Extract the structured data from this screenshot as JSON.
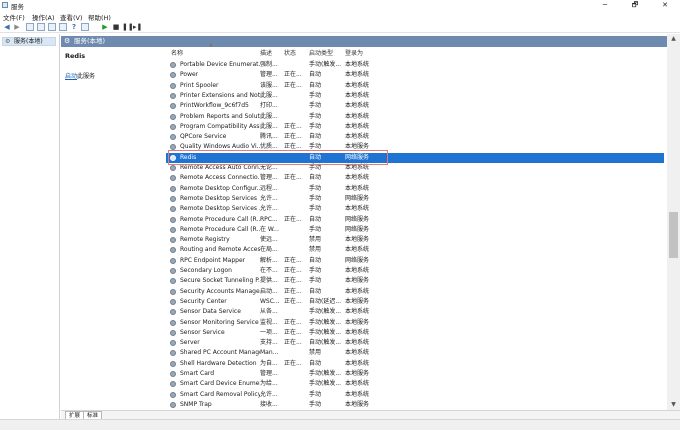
{
  "window": {
    "title": "服务",
    "minimize": "─",
    "maximize": "🗗",
    "close": "✕"
  },
  "menu": [
    "文件(F)",
    "操作(A)",
    "查看(V)",
    "帮助(H)"
  ],
  "left_pane": {
    "tree_root": "服务(本地)"
  },
  "right_pane": {
    "header": "服务(本地)",
    "selected_service": "Redis",
    "detail_link": "启动",
    "detail_link_suffix": "此服务"
  },
  "columns": [
    "名称",
    "描述",
    "状态",
    "启动类型",
    "登录为"
  ],
  "rows": [
    [
      "Portable Device Enumerat...",
      "强制...",
      "",
      "手动(触发...",
      "本地系统"
    ],
    [
      "Power",
      "管理...",
      "正在...",
      "自动",
      "本地系统"
    ],
    [
      "Print Spooler",
      "该服...",
      "正在...",
      "自动",
      "本地系统"
    ],
    [
      "Printer Extensions and Noti...",
      "此服...",
      "",
      "手动",
      "本地系统"
    ],
    [
      "PrintWorkflow_9c6f7d5",
      "打印...",
      "",
      "手动",
      "本地系统"
    ],
    [
      "Problem Reports and Solut...",
      "此服...",
      "",
      "手动",
      "本地系统"
    ],
    [
      "Program Compatibility Assi...",
      "此服...",
      "正在...",
      "手动",
      "本地系统"
    ],
    [
      "QPCore Service",
      "腾讯...",
      "正在...",
      "自动",
      "本地系统"
    ],
    [
      "Quality Windows Audio Vi...",
      "优质...",
      "正在...",
      "手动",
      "本地服务"
    ],
    [
      "Redis",
      "",
      "",
      "自动",
      "网络服务"
    ],
    [
      "Remote Access Auto Conn...",
      "无论...",
      "",
      "手动",
      "本地系统"
    ],
    [
      "Remote Access Connectio...",
      "管理...",
      "正在...",
      "自动",
      "本地系统"
    ],
    [
      "Remote Desktop Configur...",
      "远程...",
      "",
      "手动",
      "本地系统"
    ],
    [
      "Remote Desktop Services",
      "允许...",
      "",
      "手动",
      "网络服务"
    ],
    [
      "Remote Desktop Services ...",
      "允许...",
      "",
      "手动",
      "本地系统"
    ],
    [
      "Remote Procedure Call (R...",
      "RPC...",
      "正在...",
      "自动",
      "网络服务"
    ],
    [
      "Remote Procedure Call (R...",
      "在 W...",
      "",
      "手动",
      "网络服务"
    ],
    [
      "Remote Registry",
      "使远...",
      "",
      "禁用",
      "本地服务"
    ],
    [
      "Routing and Remote Access",
      "在局...",
      "",
      "禁用",
      "本地系统"
    ],
    [
      "RPC Endpoint Mapper",
      "解析...",
      "正在...",
      "自动",
      "网络服务"
    ],
    [
      "Secondary Logon",
      "在不...",
      "正在...",
      "手动",
      "本地系统"
    ],
    [
      "Secure Socket Tunneling P...",
      "提供...",
      "正在...",
      "手动",
      "本地服务"
    ],
    [
      "Security Accounts Manager",
      "启动...",
      "正在...",
      "自动",
      "本地系统"
    ],
    [
      "Security Center",
      "WSC...",
      "正在...",
      "自动(延迟...",
      "本地服务"
    ],
    [
      "Sensor Data Service",
      "从各...",
      "",
      "手动(触发...",
      "本地系统"
    ],
    [
      "Sensor Monitoring Service",
      "监视...",
      "正在...",
      "手动(触发...",
      "本地服务"
    ],
    [
      "Sensor Service",
      "一项...",
      "正在...",
      "手动(触发...",
      "本地系统"
    ],
    [
      "Server",
      "支持...",
      "正在...",
      "自动(触发...",
      "本地系统"
    ],
    [
      "Shared PC Account Manager",
      "Man...",
      "",
      "禁用",
      "本地系统"
    ],
    [
      "Shell Hardware Detection",
      "为自...",
      "正在...",
      "自动",
      "本地系统"
    ],
    [
      "Smart Card",
      "管理...",
      "",
      "手动(触发...",
      "本地服务"
    ],
    [
      "Smart Card Device Enumer...",
      "为给...",
      "",
      "手动(触发...",
      "本地系统"
    ],
    [
      "Smart Card Removal Policy",
      "允许...",
      "",
      "手动",
      "本地系统"
    ],
    [
      "SNMP Trap",
      "接收...",
      "",
      "手动",
      "本地服务"
    ]
  ],
  "bottom_tabs": [
    "扩展",
    "标准"
  ],
  "icons": {
    "back": "back-arrow-icon",
    "forward": "forward-arrow-icon",
    "play": "play-icon",
    "stop": "stop-icon",
    "pause": "pause-icon",
    "restart": "restart-icon"
  }
}
